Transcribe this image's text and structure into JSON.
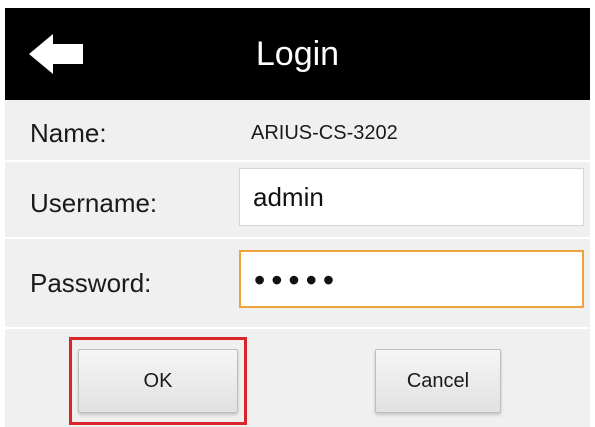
{
  "header": {
    "title": "Login",
    "back_icon": "arrow-left-icon"
  },
  "form": {
    "name_label": "Name:",
    "name_value": "ARIUS-CS-3202",
    "username_label": "Username:",
    "username_value": "admin",
    "password_label": "Password:",
    "password_value": "•••••"
  },
  "buttons": {
    "ok_label": "OK",
    "cancel_label": "Cancel"
  },
  "colors": {
    "header_bg": "#000000",
    "focus_border": "#f0a23a",
    "highlight": "#d9262b",
    "form_bg": "#f0f0f0"
  }
}
